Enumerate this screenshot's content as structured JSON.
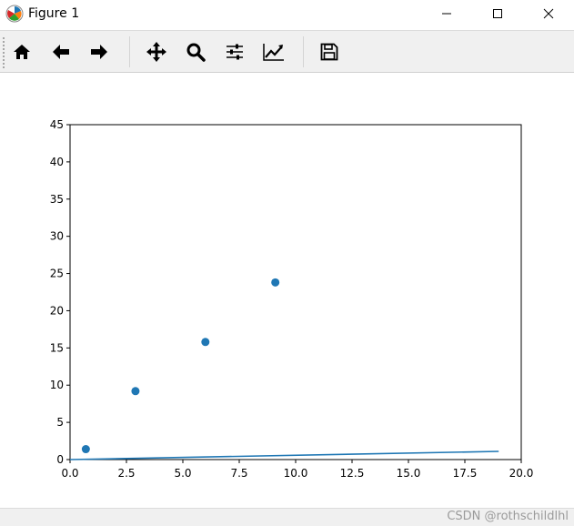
{
  "window": {
    "title": "Figure 1",
    "app_icon": "matplotlib-logo-icon",
    "controls": [
      {
        "name": "minimize-button",
        "icon": "minimize-icon"
      },
      {
        "name": "maximize-button",
        "icon": "maximize-icon"
      },
      {
        "name": "close-button",
        "icon": "close-icon"
      }
    ]
  },
  "toolbar": {
    "tools": [
      {
        "name": "home-button",
        "icon": "home-icon"
      },
      {
        "name": "back-button",
        "icon": "arrow-left-icon"
      },
      {
        "name": "forward-button",
        "icon": "arrow-right-icon"
      },
      {
        "name": "pan-button",
        "icon": "move-icon"
      },
      {
        "name": "zoom-button",
        "icon": "magnifier-icon"
      },
      {
        "name": "configure-subplots-button",
        "icon": "sliders-icon"
      },
      {
        "name": "edit-axis-button",
        "icon": "line-chart-icon"
      },
      {
        "name": "save-button",
        "icon": "floppy-disk-icon"
      }
    ]
  },
  "status": {
    "watermark": "CSDN @rothschildlhl"
  },
  "colors": {
    "series": "#1f77b4",
    "toolbar_bg": "#f0f0f0"
  },
  "chart_data": {
    "type": "scatter",
    "xlim": [
      0,
      20
    ],
    "ylim": [
      0,
      45
    ],
    "xticks": [
      "0.0",
      "2.5",
      "5.0",
      "7.5",
      "10.0",
      "12.5",
      "15.0",
      "17.5",
      "20.0"
    ],
    "yticks": [
      "0",
      "5",
      "10",
      "15",
      "20",
      "25",
      "30",
      "35",
      "40",
      "45"
    ],
    "xtick_values": [
      0,
      2.5,
      5,
      7.5,
      10,
      12.5,
      15,
      17.5,
      20
    ],
    "ytick_values": [
      0,
      5,
      10,
      15,
      20,
      25,
      30,
      35,
      40,
      45
    ],
    "grid": false,
    "series": [
      {
        "type": "scatter",
        "x": [
          0.7,
          2.9,
          6.0,
          9.1
        ],
        "y": [
          1.4,
          9.2,
          15.8,
          23.8
        ]
      },
      {
        "type": "line",
        "x": [
          0,
          19
        ],
        "y": [
          0,
          1.1
        ]
      }
    ]
  }
}
